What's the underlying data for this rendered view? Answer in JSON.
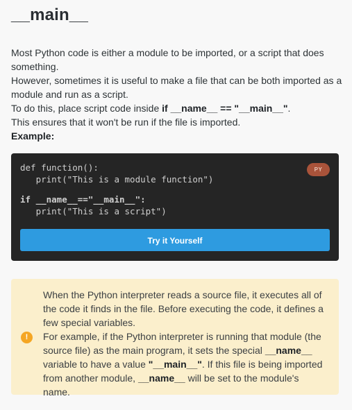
{
  "page": {
    "title": "__main__"
  },
  "intro": {
    "line1": "Most Python code is either a module to be imported, or a script that does something.",
    "line2": "However, sometimes it is useful to make a file that can be both imported as a module and run as a script.",
    "line3_prefix": "To do this, place script code inside ",
    "line3_code": "if __name__ == \"__main__\"",
    "line3_suffix": ".",
    "line4": "This ensures that it won't be run if the file is imported.",
    "example_label": "Example:"
  },
  "code_block": {
    "language_badge": "PY",
    "lines": [
      "def function():",
      "   print(\"This is a module function\")",
      "if __name__==\"__main__\":",
      "   print(\"This is a script\")"
    ],
    "try_button_label": "Try it Yourself"
  },
  "note": {
    "icon_glyph": "!",
    "para1": "When the Python interpreter reads a source file, it executes all of the code it finds in the file. Before executing the code, it defines a few special variables.",
    "para2_a": "For example, if the Python interpreter is running that module (the source file) as the main program, it sets the special ",
    "para2_b": "__name__",
    "para2_c": " variable to have a value ",
    "para2_d": "\"__main__\"",
    "para2_e": ". If this file is being imported from another module, ",
    "para2_f": "__name__",
    "para2_g": " will be set to the module's name."
  },
  "colors": {
    "background": "#f8f8f8",
    "code_background": "#252525",
    "button": "#2e9be0",
    "badge": "#a9533a",
    "note_background": "#fbefcc",
    "note_icon": "#f5a623"
  }
}
